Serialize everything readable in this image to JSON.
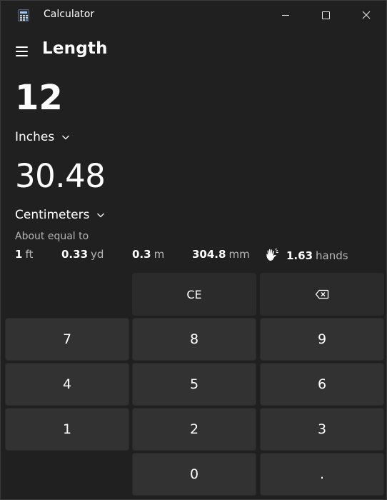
{
  "window": {
    "title": "Calculator",
    "icon": "calculator-icon",
    "controls": [
      "minimize-icon",
      "maximize-icon",
      "close-icon"
    ]
  },
  "header": {
    "menu_icon": "hamburger-menu-icon",
    "mode": "Length"
  },
  "converter": {
    "input_value": "12",
    "from_unit": "Inches",
    "output_value": "30.48",
    "to_unit": "Centimeters",
    "about_label": "About equal to",
    "equivalents": [
      {
        "value": "1",
        "unit": "ft"
      },
      {
        "value": "0.33",
        "unit": "yd"
      },
      {
        "value": "0.3",
        "unit": "m"
      },
      {
        "value": "304.8",
        "unit": "mm"
      },
      {
        "value": "1.63",
        "unit": "hands",
        "icon": "hand-icon"
      }
    ]
  },
  "keypad": {
    "ce": "CE",
    "backspace_icon": "backspace-icon",
    "keys": [
      "7",
      "8",
      "9",
      "4",
      "5",
      "6",
      "1",
      "2",
      "3",
      "0",
      "."
    ]
  },
  "colors": {
    "background": "#202020",
    "key": "#323232",
    "secondary_text": "#b5b5b5"
  }
}
